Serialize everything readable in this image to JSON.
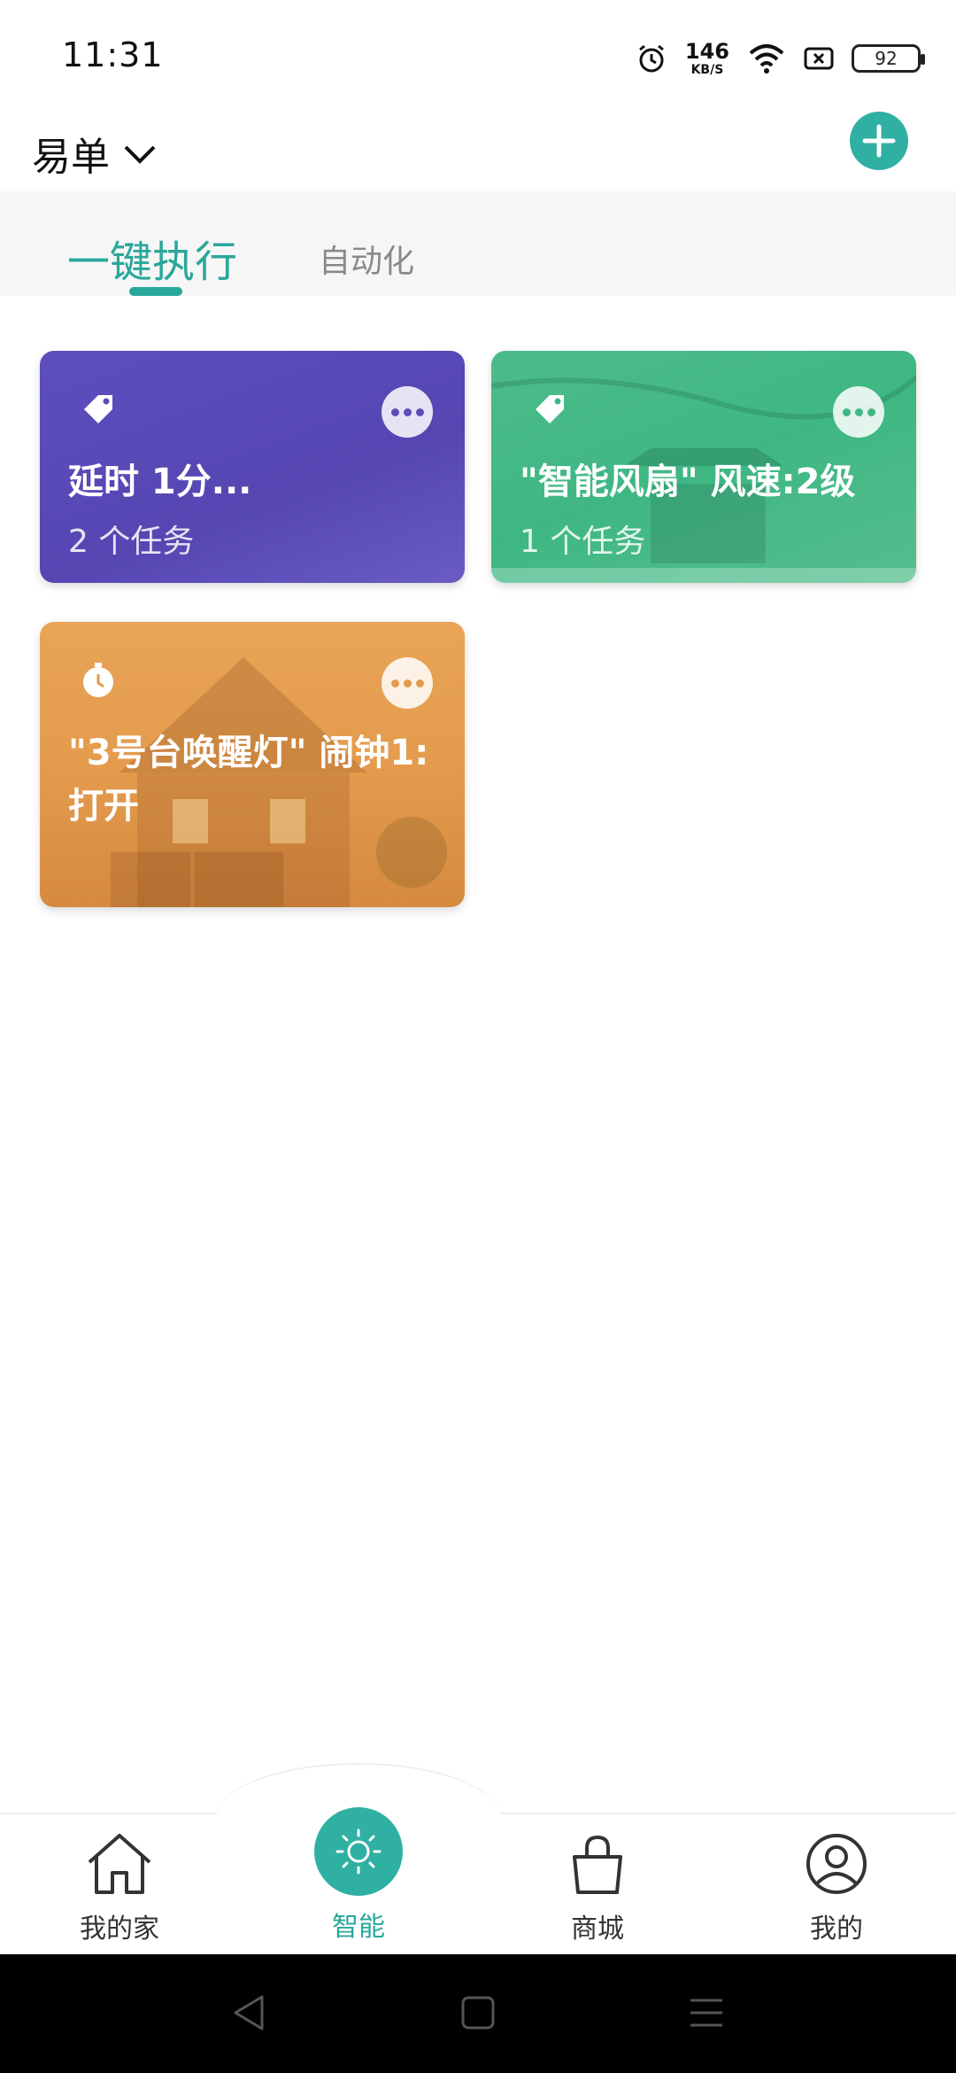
{
  "status": {
    "time": "11:31",
    "speed_value": "146",
    "speed_unit": "KB/S",
    "battery": "92"
  },
  "header": {
    "home_name": "易单"
  },
  "tabs": [
    {
      "label": "一键执行",
      "active": true
    },
    {
      "label": "自动化",
      "active": false
    }
  ],
  "cards": [
    {
      "name": "延时 1分...",
      "count": "2 个任务",
      "icon": "tag-icon",
      "color": "#5a4fb8"
    },
    {
      "name": "\"智能风扇\" 风速:2级",
      "count": "1 个任务",
      "icon": "tag-icon",
      "color": "#3fb783"
    },
    {
      "name": "\"3号台唤醒灯\" 闹钟1: 打开",
      "count": "",
      "icon": "clock-icon",
      "color": "#e39a4c"
    }
  ],
  "nav": [
    {
      "label": "我的家",
      "icon": "home-icon",
      "active": false
    },
    {
      "label": "智能",
      "icon": "sun-icon",
      "active": true
    },
    {
      "label": "商城",
      "icon": "shopping-bag-icon",
      "active": false
    },
    {
      "label": "我的",
      "icon": "user-icon",
      "active": false
    }
  ],
  "colors": {
    "accent": "#2aa79b"
  }
}
